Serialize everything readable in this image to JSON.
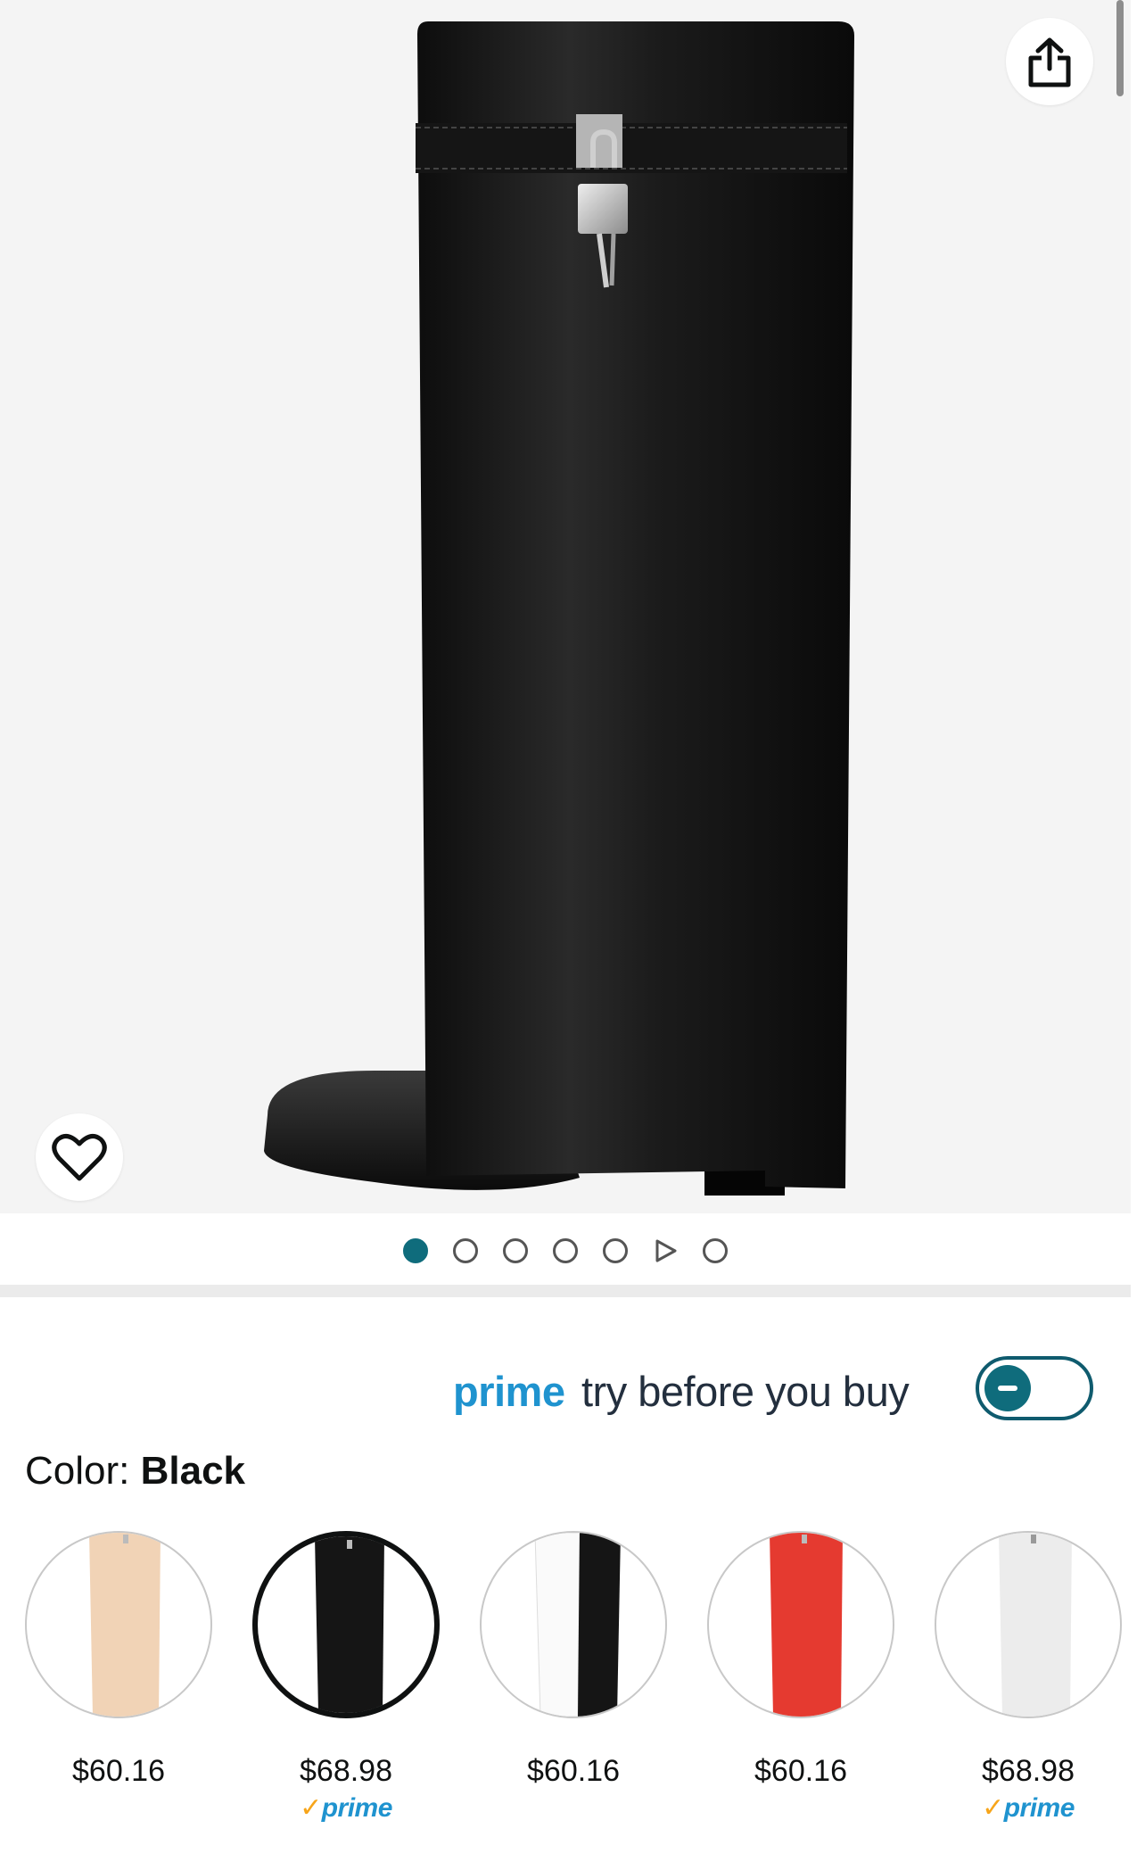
{
  "header": {
    "share_icon": "share-icon",
    "wishlist_icon": "heart-icon"
  },
  "gallery": {
    "image_subject": "black-knee-high-fold-over-boot-with-padlock",
    "dots": [
      {
        "type": "image",
        "active": true
      },
      {
        "type": "image",
        "active": false
      },
      {
        "type": "image",
        "active": false
      },
      {
        "type": "image",
        "active": false
      },
      {
        "type": "image",
        "active": false
      },
      {
        "type": "video",
        "active": false
      },
      {
        "type": "image",
        "active": false
      }
    ]
  },
  "prime_try": {
    "brand": "prime",
    "tagline": "try before you buy",
    "toggle_state": "off"
  },
  "color": {
    "label": "Color:",
    "selected": "Black"
  },
  "swatches": [
    {
      "name": "beige",
      "color": "#f0d2b4",
      "price": "$60.16",
      "prime": false,
      "selected": false
    },
    {
      "name": "black",
      "color": "#1a1a1a",
      "price": "$68.98",
      "prime": true,
      "prime_label": "prime",
      "selected": true
    },
    {
      "name": "white-black",
      "color": "#ffffff",
      "price": "$60.16",
      "prime": false,
      "selected": false
    },
    {
      "name": "red",
      "color": "#e43a31",
      "price": "$60.16",
      "prime": false,
      "selected": false
    },
    {
      "name": "white",
      "color": "#eeeeee",
      "price": "$68.98",
      "prime": true,
      "prime_label": "prime",
      "selected": false
    }
  ],
  "colors": {
    "accent_teal": "#0f6c7c",
    "prime_blue": "#1f93cf",
    "prime_check": "#f7a51a"
  }
}
